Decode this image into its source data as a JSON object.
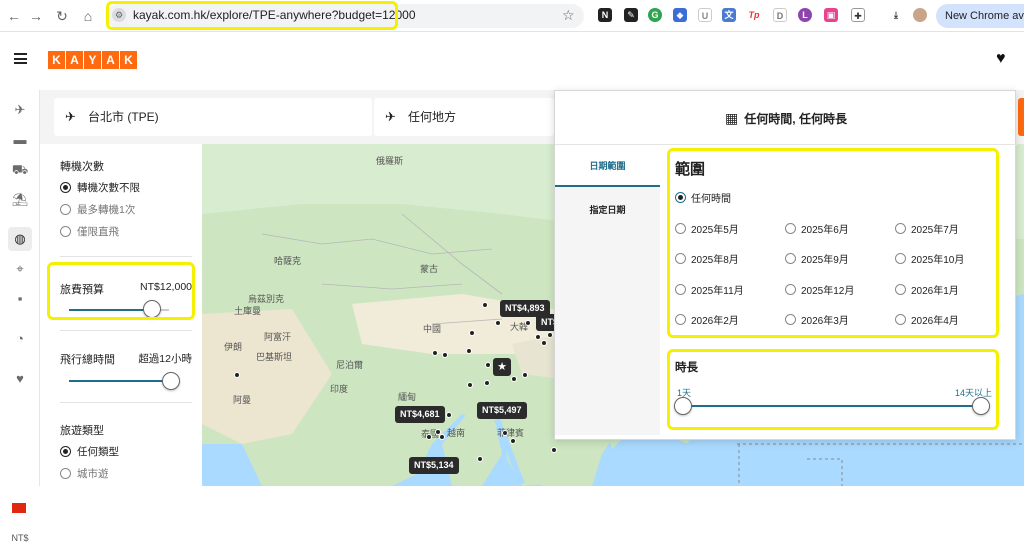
{
  "browser": {
    "url": "kayak.com.hk/explore/TPE-anywhere?budget=12000",
    "new_chrome": "New Chrome available"
  },
  "kayak": {
    "logo_letters": [
      "K",
      "A",
      "Y",
      "A",
      "K"
    ],
    "brand_color": "#ff690f",
    "currency": "NT$"
  },
  "search": {
    "origin": "台北市 (TPE)",
    "destination": "任何地方"
  },
  "filters": {
    "stops": {
      "title": "轉機次數",
      "options": [
        {
          "label": "轉機次數不限",
          "selected": true
        },
        {
          "label": "最多轉機1次",
          "selected": false
        },
        {
          "label": "僅限直飛",
          "selected": false
        }
      ]
    },
    "budget": {
      "title": "旅費預算",
      "value": "NT$12,000"
    },
    "duration": {
      "title": "飛行總時間",
      "value": "超過12小時"
    },
    "trip_type": {
      "title": "旅遊類型",
      "options": [
        {
          "label": "任何類型",
          "selected": true
        },
        {
          "label": "城市遊",
          "selected": false
        }
      ]
    }
  },
  "map": {
    "labels": [
      {
        "text": "俄羅斯"
      },
      {
        "text": "哈薩克"
      },
      {
        "text": "蒙古"
      },
      {
        "text": "烏茲別克"
      },
      {
        "text": "土庫曼"
      },
      {
        "text": "阿富汗"
      },
      {
        "text": "伊朗"
      },
      {
        "text": "巴基斯坦"
      },
      {
        "text": "尼泊爾"
      },
      {
        "text": "中國"
      },
      {
        "text": "印度"
      },
      {
        "text": "緬甸"
      },
      {
        "text": "泰國"
      },
      {
        "text": "越南"
      },
      {
        "text": "菲律賓"
      },
      {
        "text": "阿曼"
      },
      {
        "text": "大韓"
      }
    ],
    "price_pins": [
      {
        "text": "NT$4,893"
      },
      {
        "text": "NT$"
      },
      {
        "text": "NT$4,681"
      },
      {
        "text": "NT$5,497"
      },
      {
        "text": "NT$5,134"
      }
    ]
  },
  "date_picker": {
    "header": "任何時間, 任何時長",
    "tabs": [
      {
        "label": "日期範圍",
        "active": true
      },
      {
        "label": "指定日期",
        "active": false
      }
    ],
    "range_title": "範圍",
    "any_time": "任何時間",
    "months": [
      "2025年5月",
      "2025年6月",
      "2025年7月",
      "2025年8月",
      "2025年9月",
      "2025年10月",
      "2025年11月",
      "2025年12月",
      "2026年1月",
      "2026年2月",
      "2026年3月",
      "2026年4月"
    ],
    "duration_title": "時長",
    "duration_min": "1天",
    "duration_max": "14天以上"
  }
}
